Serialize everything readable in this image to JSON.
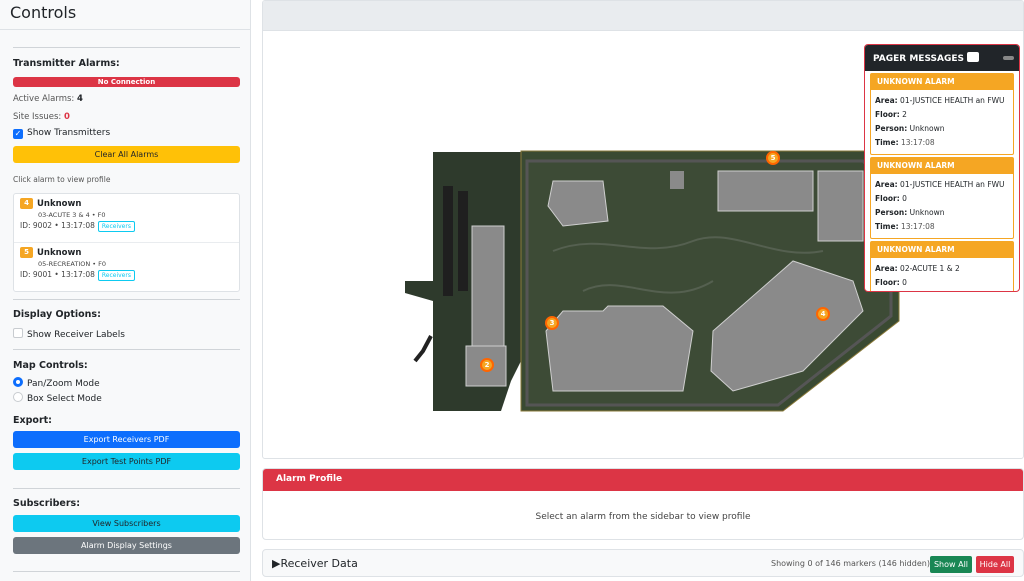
{
  "sidebar": {
    "title": "Controls",
    "transmitter": {
      "title": "Transmitter Alarms:",
      "status": "No Connection",
      "active_label": "Active Alarms:",
      "active_count": "4",
      "issues_label": "Site Issues:",
      "issues_count": "0",
      "show_transmitters": "Show Transmitters",
      "clear_all": "Clear All Alarms",
      "click_hint": "Click alarm to view profile"
    },
    "alarms": [
      {
        "badge": "4",
        "name": "Unknown",
        "location": "03-ACUTE 3 & 4 • F0",
        "meta": "ID: 9002 • 13:17:08",
        "button": "Receivers"
      },
      {
        "badge": "5",
        "name": "Unknown",
        "location": "05-RECREATION • F0",
        "meta": "ID: 9001 • 13:17:08",
        "button": "Receivers"
      }
    ],
    "display": {
      "title": "Display Options:",
      "receiver_labels": "Show Receiver Labels"
    },
    "map_controls": {
      "title": "Map Controls:",
      "pan_zoom": "Pan/Zoom Mode",
      "box_select": "Box Select Mode"
    },
    "export": {
      "title": "Export:",
      "receivers_pdf": "Export Receivers PDF",
      "test_points_pdf": "Export Test Points PDF"
    },
    "subscribers": {
      "title": "Subscribers:",
      "view": "View Subscribers",
      "settings": "Alarm Display Settings"
    }
  },
  "map": {
    "markers": [
      "5",
      "3",
      "4",
      "2"
    ]
  },
  "pager": {
    "title": "PAGER MESSAGES",
    "messages": [
      {
        "head": "UNKNOWN ALARM",
        "area_label": "Area:",
        "area": "01-JUSTICE HEALTH an FWU",
        "floor_label": "Floor:",
        "floor": "2",
        "person_label": "Person:",
        "person": "Unknown",
        "time_label": "Time:",
        "time": "13:17:08"
      },
      {
        "head": "UNKNOWN ALARM",
        "area_label": "Area:",
        "area": "01-JUSTICE HEALTH an FWU",
        "floor_label": "Floor:",
        "floor": "0",
        "person_label": "Person:",
        "person": "Unknown",
        "time_label": "Time:",
        "time": "13:17:08"
      },
      {
        "head": "UNKNOWN ALARM",
        "area_label": "Area:",
        "area": "02-ACUTE 1 & 2",
        "floor_label": "Floor:",
        "floor": "0"
      }
    ]
  },
  "profile": {
    "title": "Alarm Profile",
    "empty": "Select an alarm from the sidebar to view profile"
  },
  "receiver": {
    "title": "▶Receiver Data",
    "count": "Showing 0 of 146 markers (146 hidden)",
    "show_all": "Show All",
    "hide_all": "Hide All"
  },
  "colors": {
    "danger": "#dc3545",
    "warning": "#ffc107",
    "primary": "#0d6efd",
    "info": "#0dcaf0",
    "secondary": "#6c757d",
    "success": "#198754",
    "alarm_orange": "#f5a623"
  }
}
